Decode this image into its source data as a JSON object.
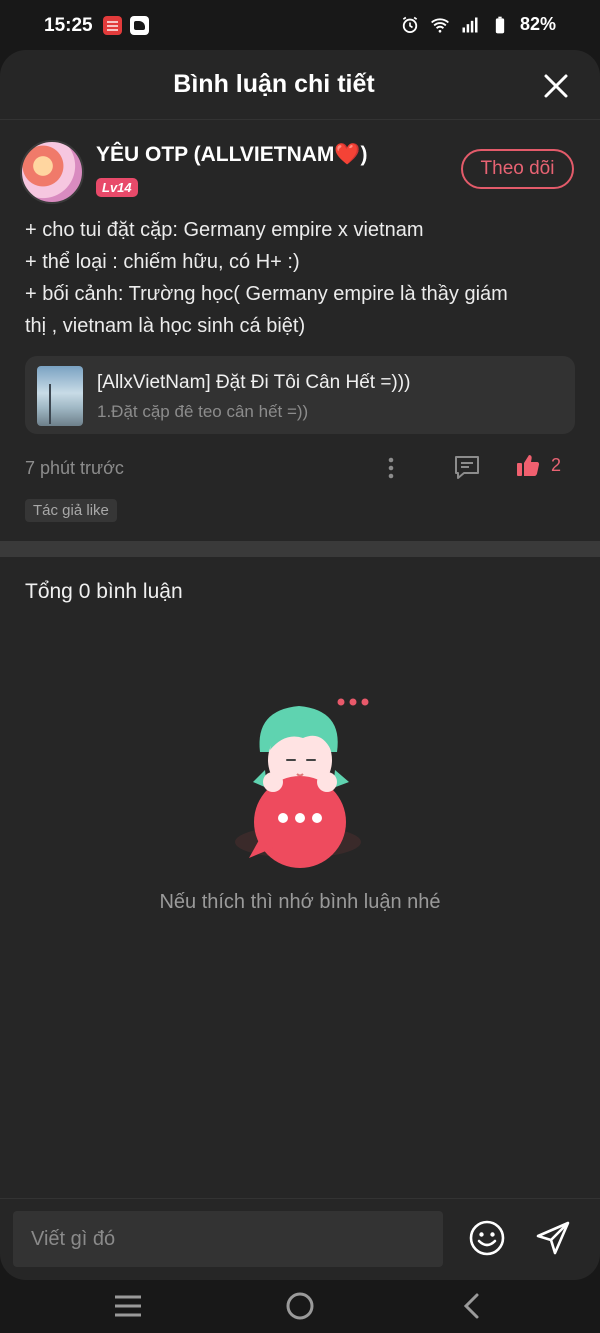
{
  "status_bar": {
    "time": "15:25",
    "battery": "82%",
    "icons": [
      "alarm-icon",
      "wifi-icon",
      "signal-icon",
      "battery-icon"
    ]
  },
  "sheet": {
    "title": "Bình luận chi tiết",
    "close_icon": "close-icon"
  },
  "post": {
    "username": "YÊU OTP (ALLVIETNAM❤️)",
    "level": "Lv14",
    "follow_label": "Theo dõi",
    "lines": [
      "+ cho tui đặt cặp: Germany empire x vietnam",
      "+ thể loại : chiếm hữu, có H+ :)",
      "+ bối cảnh: Trường học( Germany empire là thầy giám",
      "thị , vietnam là học sinh cá biệt)"
    ],
    "linked_card": {
      "title": "[AllxVietNam] Đặt Đi Tôi Cân Hết =)))",
      "subtitle": "1.Đặt cặp đê teo cân hết =))"
    },
    "time": "7 phút trước",
    "like_count": "2",
    "author_like_badge": "Tác giả like"
  },
  "comments": {
    "total_label": "Tổng 0 bình luận",
    "empty_message": "Nếu thích thì nhớ bình luận nhé"
  },
  "input": {
    "placeholder": "Viết gì đó"
  },
  "colors": {
    "accent": "#e86373",
    "background": "#262626",
    "surface": "#323232"
  }
}
